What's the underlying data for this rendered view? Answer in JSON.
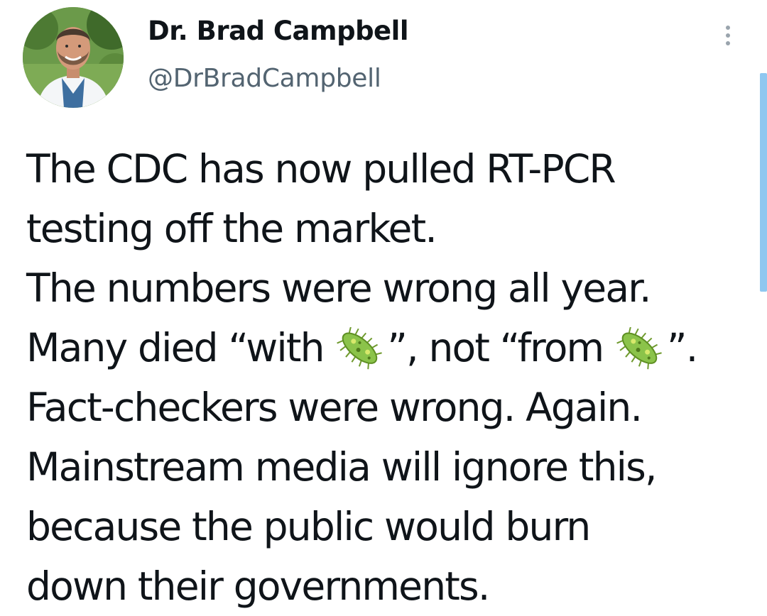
{
  "author": {
    "display_name": "Dr. Brad Campbell",
    "handle": "@DrBradCampbell",
    "avatar_icon": "profile-photo-avatar"
  },
  "menu": {
    "icon": "more-vertical-icon"
  },
  "tweet": {
    "lines": {
      "l1": "The CDC has now pulled RT-PCR",
      "l2": "testing off the market.",
      "l3": "The numbers were wrong all year.",
      "l4a": "Many died “with ",
      "l4b": "”, not “from ",
      "l4c": "”.",
      "l5": "Fact-checkers were wrong. Again.",
      "l6": "Mainstream media will ignore this,",
      "l7": "because the public would burn",
      "l8": "down their governments."
    },
    "emoji": "microbe-emoji"
  },
  "colors": {
    "text": "#0f1419",
    "handle": "#536471",
    "scroll_indicator": "#8fc7f0",
    "microbe_green": "#8bc34a"
  }
}
